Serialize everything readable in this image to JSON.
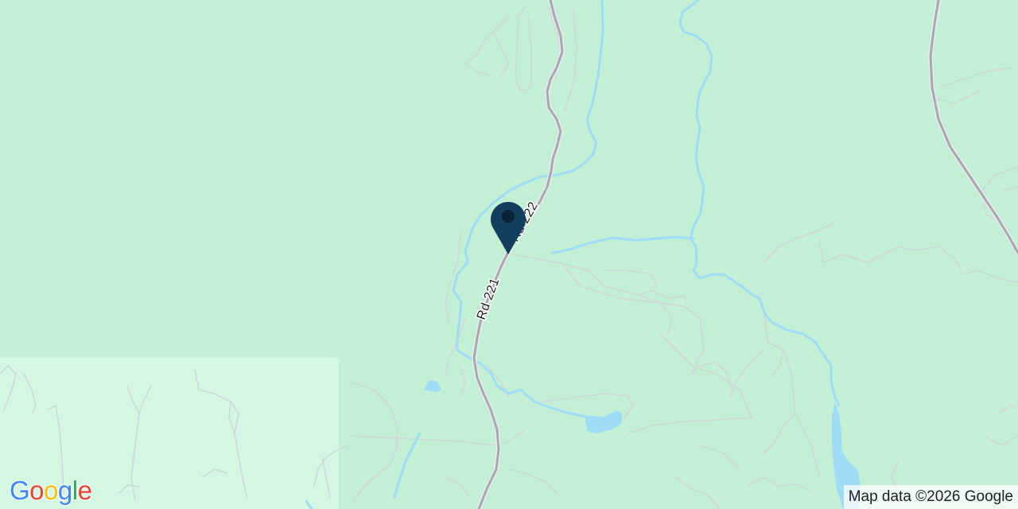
{
  "map": {
    "colors": {
      "land": "#c3f0d5",
      "park": "#d4f7e4",
      "water": "#9fdcf5",
      "highway": "#a8a8b0",
      "track": "#d2d6db",
      "marker": "#133e5d"
    },
    "roads": [
      {
        "label": "Rd 222"
      },
      {
        "label": "Rd 221"
      }
    ],
    "marker": {
      "icon": "map-pin-icon"
    },
    "attribution": "Map data ©2026 Google",
    "logo": {
      "letters": [
        "G",
        "o",
        "o",
        "g",
        "l",
        "e"
      ],
      "icon": "google-logo"
    }
  }
}
